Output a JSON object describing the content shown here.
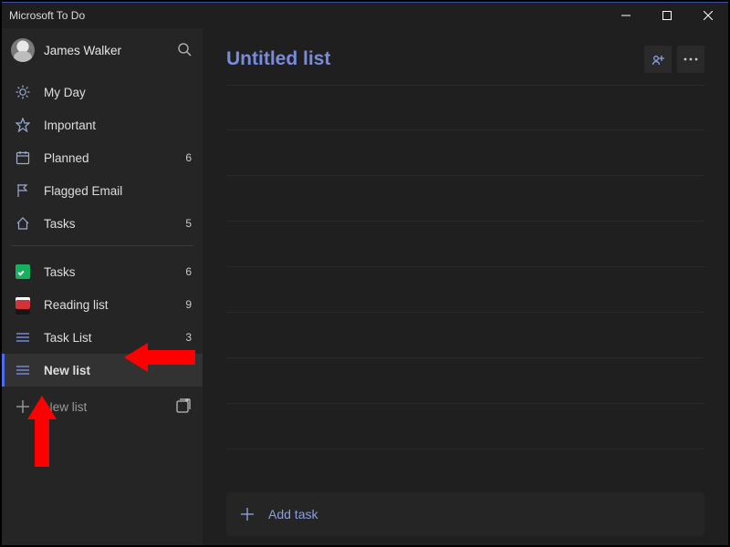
{
  "window": {
    "title": "Microsoft To Do"
  },
  "profile": {
    "name": "James Walker"
  },
  "sidebar": {
    "smart_lists": [
      {
        "iconColor": "#8aa0c7",
        "label": "My Day",
        "count": ""
      },
      {
        "iconColor": "#8aa0c7",
        "label": "Important",
        "count": ""
      },
      {
        "iconColor": "#8aa0c7",
        "label": "Planned",
        "count": "6"
      },
      {
        "iconColor": "#8aa0c7",
        "label": "Flagged Email",
        "count": ""
      },
      {
        "iconColor": "#8aa0c7",
        "label": "Tasks",
        "count": "5"
      }
    ],
    "user_lists": [
      {
        "kind": "green",
        "label": "Tasks",
        "count": "6"
      },
      {
        "kind": "red",
        "label": "Reading list",
        "count": "9"
      },
      {
        "kind": "lines",
        "label": "Task List",
        "count": "3"
      },
      {
        "kind": "lines",
        "label": "New list",
        "count": "",
        "selected": true
      }
    ],
    "new_list_label": "New list"
  },
  "main": {
    "title": "Untitled list",
    "add_task_label": "Add task"
  },
  "colors": {
    "accent": "#788cde",
    "sidebar_bg": "#252525",
    "main_bg": "#1f1f1f"
  }
}
